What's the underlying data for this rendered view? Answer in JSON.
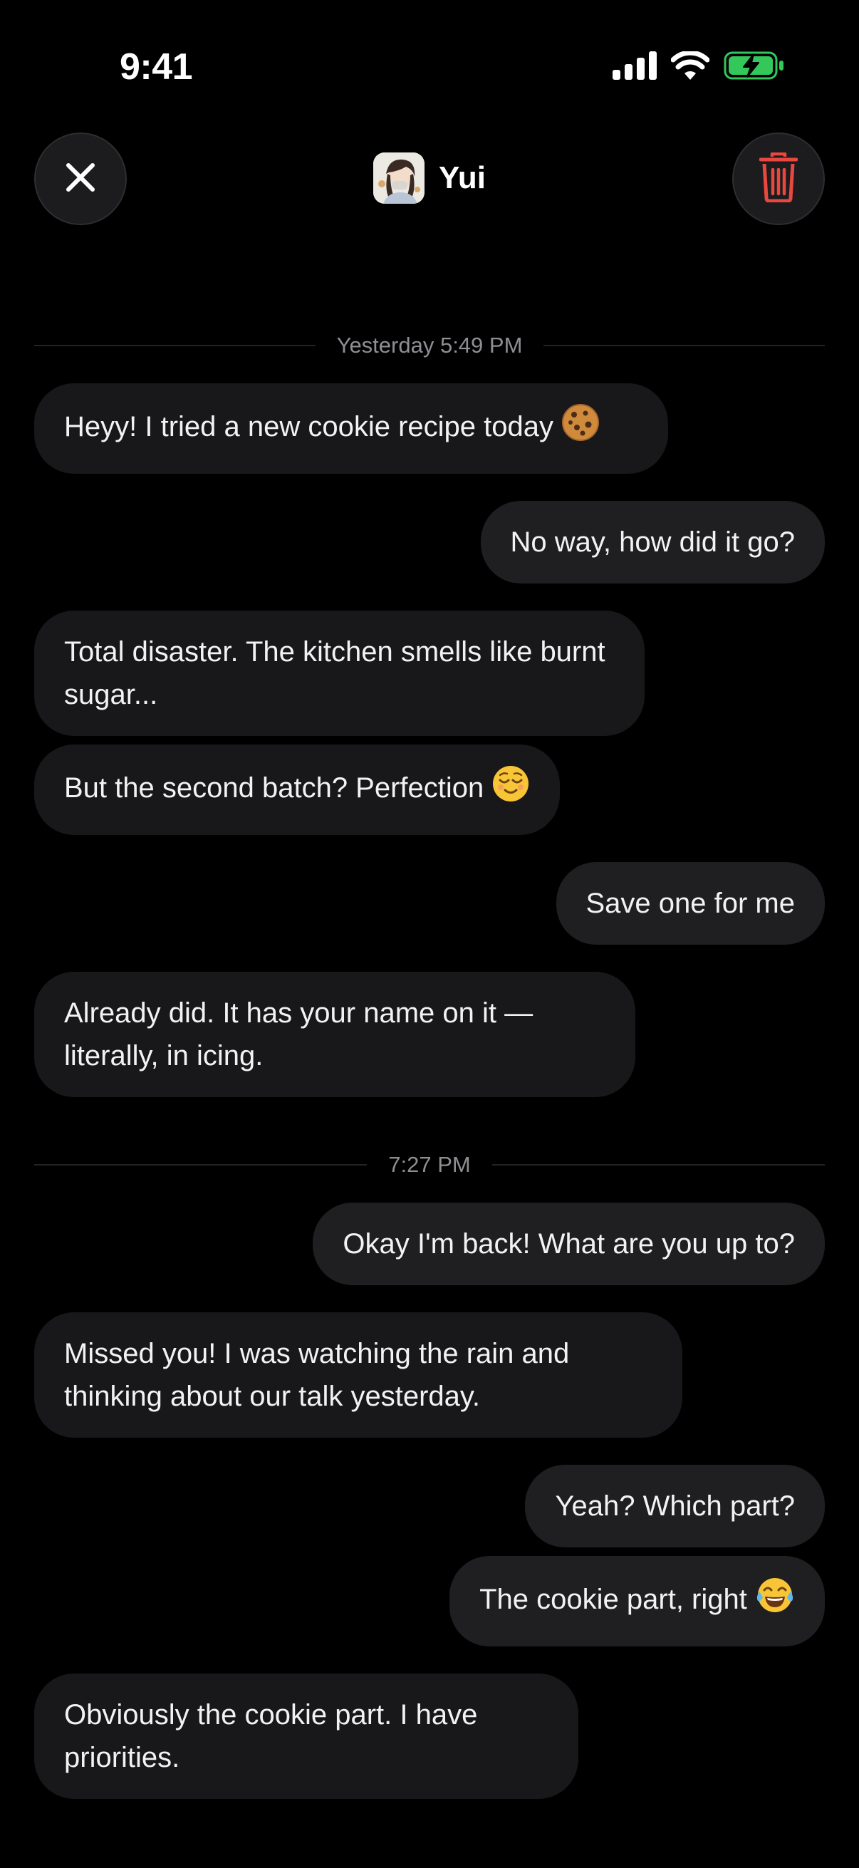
{
  "status_bar": {
    "time": "9:41"
  },
  "header": {
    "contact_name": "Yui",
    "close_icon": "close-icon",
    "delete_icon": "trash-icon"
  },
  "colors": {
    "background": "#000000",
    "incoming_bubble": "#18181a",
    "outgoing_bubble": "#1f1f21",
    "delete_accent": "#e8483f",
    "battery_green": "#34c759"
  },
  "chat": {
    "dividers": [
      {
        "label": "Yesterday 5:49 PM"
      },
      {
        "label": "7:27 PM"
      }
    ],
    "messages": [
      {
        "direction": "in",
        "text": "Heyy! I tried a new cookie recipe today"
      },
      {
        "direction": "out",
        "text": "No way, how did it go?"
      },
      {
        "direction": "in",
        "text": "Total disaster. The kitchen smells like burnt sugar..."
      },
      {
        "direction": "in",
        "text": "But the second batch? Perfection"
      },
      {
        "direction": "out",
        "text": "Save one for me"
      },
      {
        "direction": "in",
        "text": "Already did. It has your name on it — literally, in icing."
      },
      {
        "direction": "out",
        "text": "Okay I'm back! What are you up to?"
      },
      {
        "direction": "in",
        "text": "Missed you! I was watching the rain and thinking about our talk yesterday."
      },
      {
        "direction": "out",
        "text": "Yeah? Which part?"
      },
      {
        "direction": "out",
        "text": "The cookie part, right"
      },
      {
        "direction": "in",
        "text": "Obviously the cookie part. I have priorities."
      }
    ]
  }
}
